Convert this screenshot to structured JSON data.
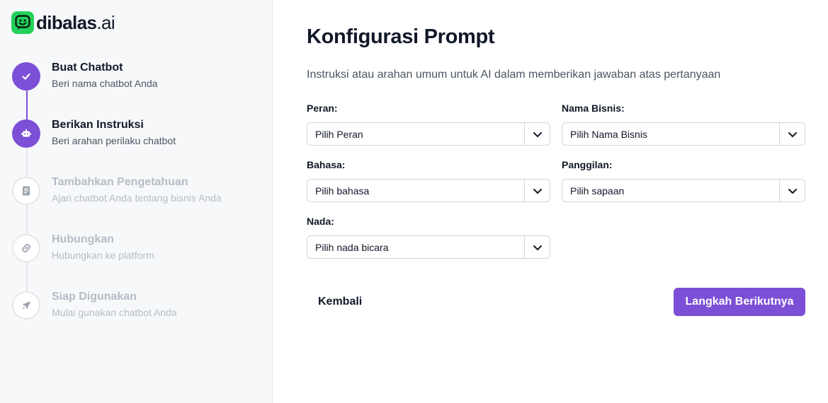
{
  "brand": {
    "name": "dibalas",
    "suffix": ".ai",
    "color": "#22d15a"
  },
  "colors": {
    "accent": "#7c4fd6",
    "muted": "#b6bcc6"
  },
  "steps": [
    {
      "title": "Buat Chatbot",
      "subtitle": "Beri nama chatbot Anda",
      "status": "done",
      "icon": "check-icon"
    },
    {
      "title": "Berikan Instruksi",
      "subtitle": "Beri arahan perilaku chatbot",
      "status": "current",
      "icon": "robot-icon"
    },
    {
      "title": "Tambahkan Pengetahuan",
      "subtitle": "Ajari chatbot Anda tentang bisnis Anda",
      "status": "pending",
      "icon": "book-icon"
    },
    {
      "title": "Hubungkan",
      "subtitle": "Hubungkan ke platform",
      "status": "pending",
      "icon": "link-icon"
    },
    {
      "title": "Siap Digunakan",
      "subtitle": "Mulai gunakan chatbot Anda",
      "status": "pending",
      "icon": "rocket-icon"
    }
  ],
  "page": {
    "title": "Konfigurasi Prompt",
    "description": "Instruksi atau arahan umum untuk AI dalam memberikan jawaban atas pertanyaan"
  },
  "fields": {
    "peran": {
      "label": "Peran:",
      "value": "Pilih Peran"
    },
    "nama_bisnis": {
      "label": "Nama Bisnis:",
      "value": "Pilih Nama Bisnis"
    },
    "bahasa": {
      "label": "Bahasa:",
      "value": "Pilih bahasa"
    },
    "panggilan": {
      "label": "Panggilan:",
      "value": "Pilih sapaan"
    },
    "nada": {
      "label": "Nada:",
      "value": "Pilih nada bicara"
    }
  },
  "actions": {
    "back_label": "Kembali",
    "next_label": "Langkah Berikutnya"
  }
}
